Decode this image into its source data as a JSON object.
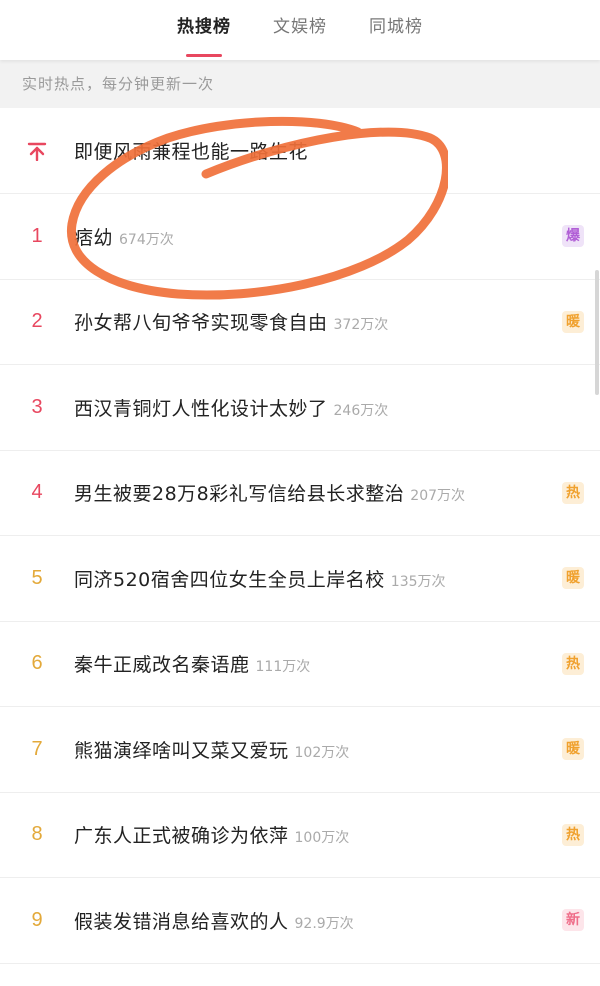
{
  "tabs": [
    {
      "label": "热搜榜"
    },
    {
      "label": "文娱榜"
    },
    {
      "label": "同城榜"
    }
  ],
  "notice": "实时热点，每分钟更新一次",
  "pinned": {
    "icon": "pin-top-icon",
    "title": "即便风雨兼程也能一路生花"
  },
  "items": [
    {
      "rank": "1",
      "title": "痞幼",
      "count": "674万次",
      "badge": "爆"
    },
    {
      "rank": "2",
      "title": "孙女帮八旬爷爷实现零食自由",
      "count": "372万次",
      "badge": "暖"
    },
    {
      "rank": "3",
      "title": "西汉青铜灯人性化设计太妙了",
      "count": "246万次",
      "badge": ""
    },
    {
      "rank": "4",
      "title": "男生被要28万8彩礼写信给县长求整治",
      "count": "207万次",
      "badge": "热"
    },
    {
      "rank": "5",
      "title": "同济520宿舍四位女生全员上岸名校",
      "count": "135万次",
      "badge": "暖"
    },
    {
      "rank": "6",
      "title": "秦牛正威改名秦语鹿",
      "count": "111万次",
      "badge": "热"
    },
    {
      "rank": "7",
      "title": "熊猫演绎啥叫又菜又爱玩",
      "count": "102万次",
      "badge": "暖"
    },
    {
      "rank": "8",
      "title": "广东人正式被确诊为依萍",
      "count": "100万次",
      "badge": "热"
    },
    {
      "rank": "9",
      "title": "假装发错消息给喜欢的人",
      "count": "92.9万次",
      "badge": "新"
    }
  ],
  "colors": {
    "accent": "#e8475f",
    "rank_top": "#e8475f",
    "rank_other": "#e3a93a",
    "annotation": "#f0703a"
  }
}
